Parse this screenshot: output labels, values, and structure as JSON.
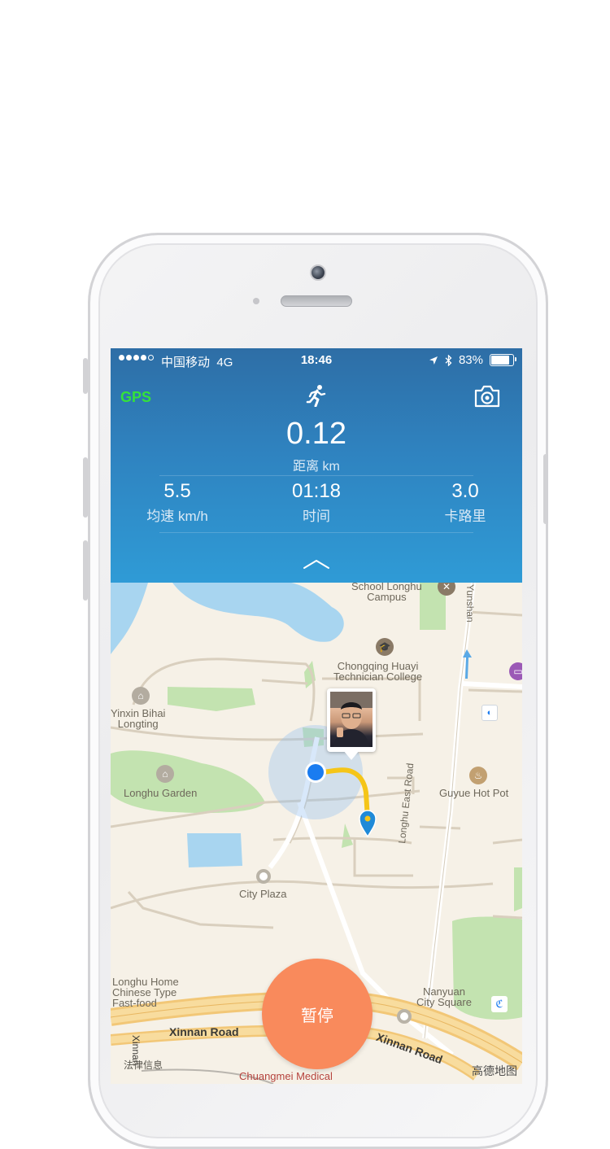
{
  "status_bar": {
    "carrier": "中国移动",
    "network": "4G",
    "time": "18:46",
    "battery": "83%",
    "battery_level": 0.83
  },
  "header": {
    "gps_label": "GPS",
    "runner_icon": "runner-icon",
    "camera_icon": "camera-icon"
  },
  "stats": {
    "distance_value": "0.12",
    "distance_label": "距离 km",
    "speed_value": "5.5",
    "speed_label": "均速 km/h",
    "time_value": "01:18",
    "time_label": "时间",
    "calories_value": "3.0",
    "calories_label": "卡路里"
  },
  "map": {
    "labels": {
      "school_line1": "School Longhu",
      "school_line2": "Campus",
      "college_line1": "Chongqing Huayi",
      "college_line2": "Technician College",
      "yinxin_line1": "Yinxin Bihai",
      "yinxin_line2": "Longting",
      "longhu_garden": "Longhu Garden",
      "guyue": "Guyue Hot Pot",
      "city_plaza": "City Plaza",
      "longhu_east_road": "Longhu East Road",
      "yunshan": "Yunshan",
      "fastfood_line1": "Longhu Home",
      "fastfood_line2": "Chinese Type",
      "fastfood_line3": "Fast-food",
      "nanyuan_line1": "Nanyuan",
      "nanyuan_line2": "City Square",
      "xinnan_road_left": "Xinnan Road",
      "xinnan_road_right": "Xinnan Road",
      "xinnan_vertical": "Xinnan",
      "chuangmei": "Chuangmei Medical",
      "legal": "法律信息",
      "amap_logo": "高德地图"
    }
  },
  "controls": {
    "pause_label": "暂停"
  },
  "colors": {
    "panel_top": "#2e6ea6",
    "panel_bottom": "#2f9bd6",
    "gps_green": "#34e23a",
    "pause_orange": "#f98a5c",
    "route_yellow": "#f5c518",
    "location_blue": "#1a7cf0"
  }
}
